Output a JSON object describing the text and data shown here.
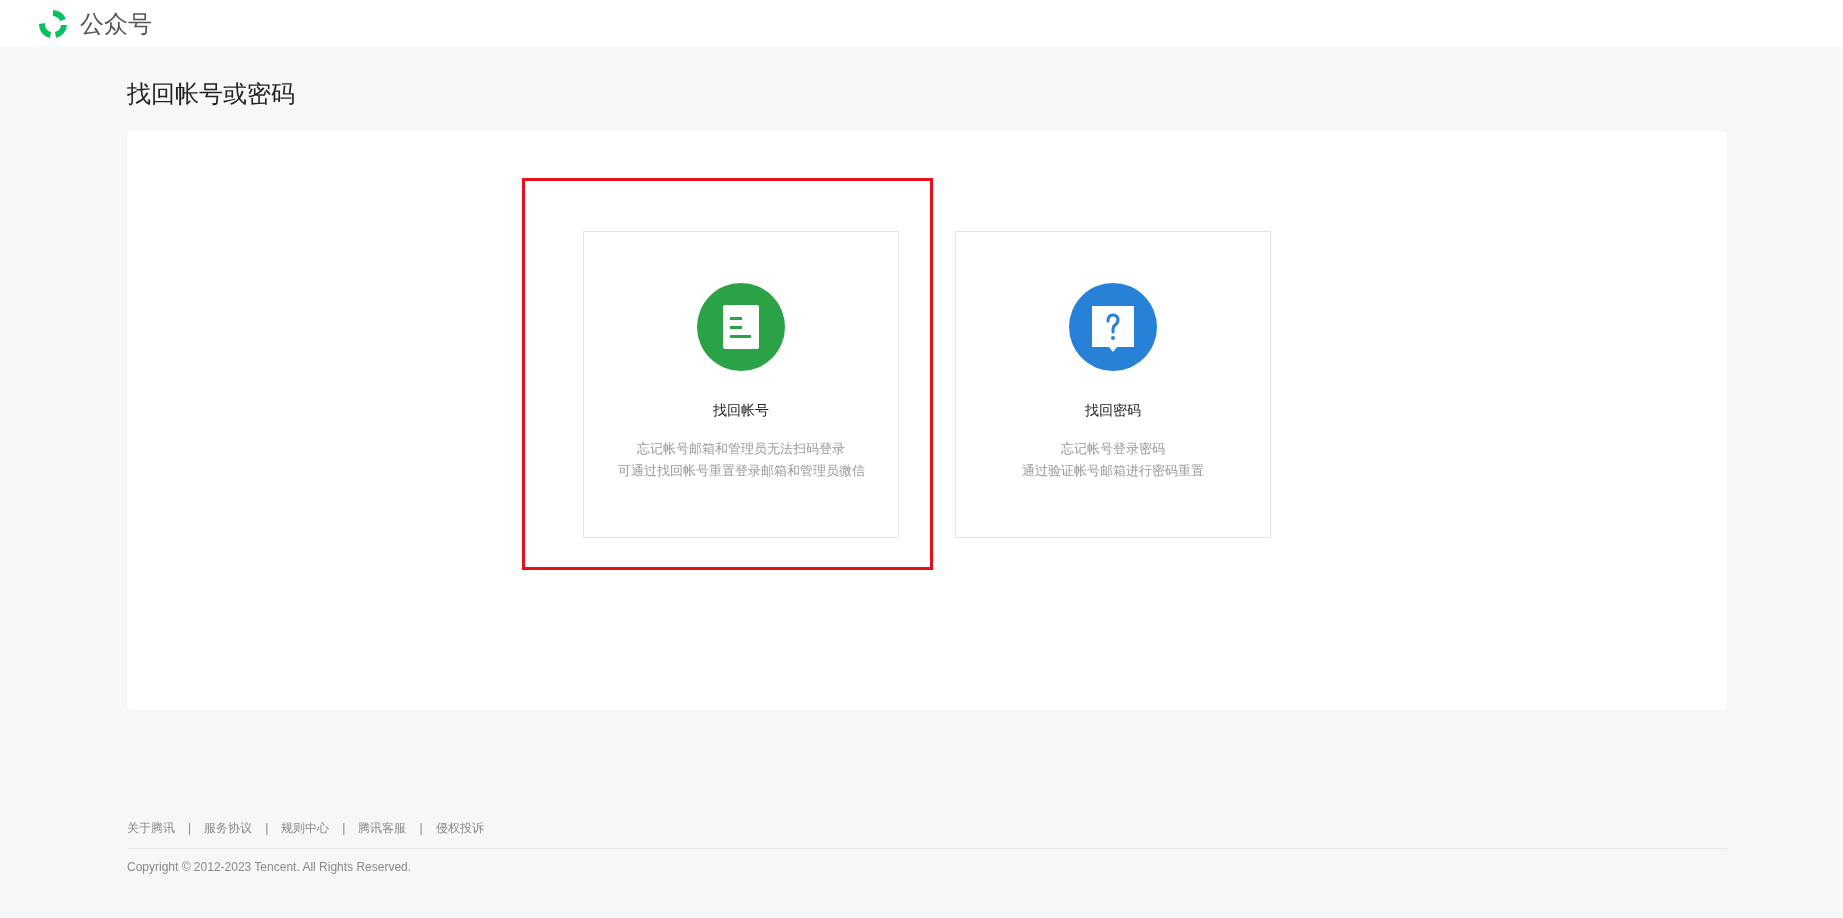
{
  "header": {
    "brand": "公众号"
  },
  "page_title": "找回帐号或密码",
  "options": [
    {
      "kind": "account",
      "title": "找回帐号",
      "highlighted": true,
      "lines": [
        "忘记帐号邮箱和管理员无法扫码登录",
        "可通过找回帐号重置登录邮箱和管理员微信"
      ]
    },
    {
      "kind": "password",
      "title": "找回密码",
      "highlighted": false,
      "lines": [
        "忘记帐号登录密码",
        "通过验证帐号邮箱进行密码重置"
      ]
    }
  ],
  "footer": {
    "items": [
      {
        "kind": "link",
        "text": "关于腾讯"
      },
      {
        "kind": "separator",
        "text": "|"
      },
      {
        "kind": "link",
        "text": "服务协议"
      },
      {
        "kind": "separator",
        "text": "|"
      },
      {
        "kind": "link",
        "text": "规则中心"
      },
      {
        "kind": "separator",
        "text": "|"
      },
      {
        "kind": "link",
        "text": "腾讯客服"
      },
      {
        "kind": "separator",
        "text": "|"
      },
      {
        "kind": "link",
        "text": "侵权投诉"
      }
    ],
    "copyright": "Copyright © 2012-2023 Tencent. All Rights Reserved."
  }
}
